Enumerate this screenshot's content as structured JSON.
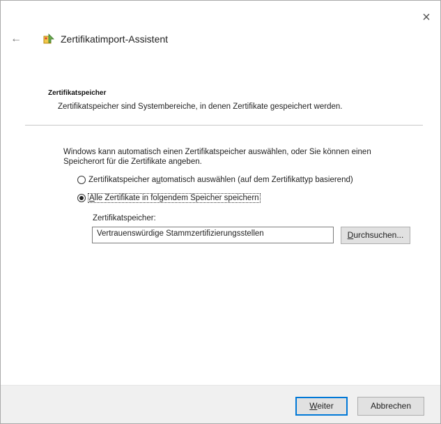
{
  "window": {
    "close_symbol": "×"
  },
  "header": {
    "back_symbol": "←",
    "title": "Zertifikatimport-Assistent"
  },
  "section": {
    "title": "Zertifikatspeicher",
    "description": "Zertifikatspeicher sind Systembereiche, in denen Zertifikate gespeichert werden."
  },
  "intro": "Windows kann automatisch einen Zertifikatspeicher auswählen, oder Sie können einen Speicherort für die Zertifikate angeben.",
  "options": {
    "auto": {
      "label_before": "Zertifikatspeicher a",
      "label_accel": "u",
      "label_after": "tomatisch auswählen (auf dem Zertifikattyp basierend)",
      "checked": false
    },
    "manual": {
      "label_accel": "A",
      "label_after": "lle Zertifikate in folgendem Speicher speichern",
      "checked": true
    }
  },
  "store": {
    "label": "Zertifikatspeicher:",
    "value": "Vertrauenswürdige Stammzertifizierungsstellen",
    "browse_accel": "D",
    "browse_rest": "urchsuchen..."
  },
  "footer": {
    "next_accel": "W",
    "next_rest": "eiter",
    "cancel_label": "Abbrechen"
  },
  "icons": {
    "back": "back-arrow-icon",
    "wizard": "certificate-wizard-icon",
    "close": "close-icon"
  }
}
